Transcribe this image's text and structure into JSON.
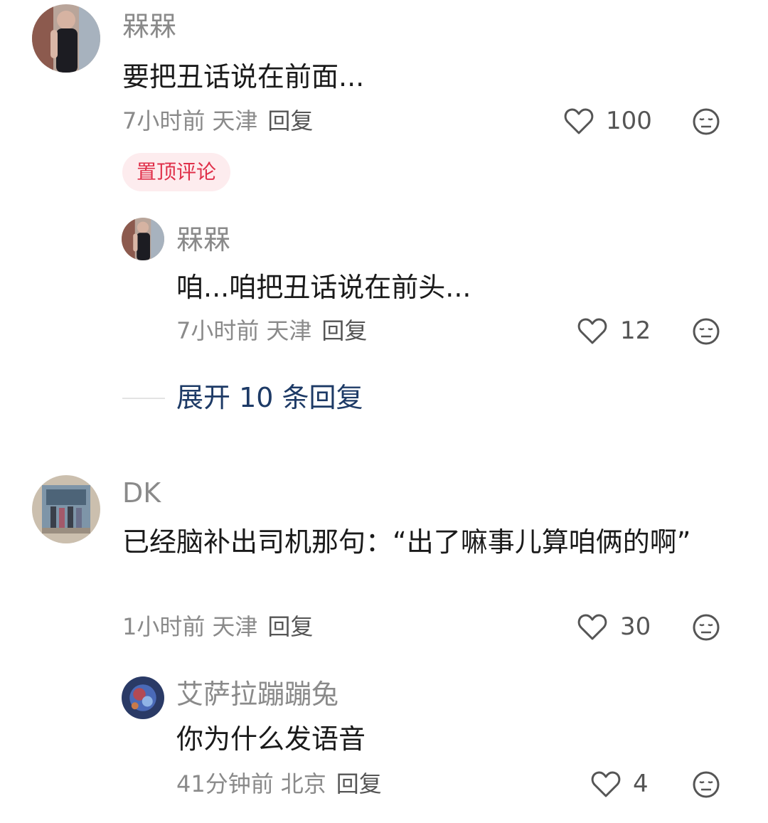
{
  "comments": [
    {
      "username": "槑槑",
      "content": "要把丑话说在前面...",
      "time": "7小时前",
      "location": "天津",
      "reply_label": "回复",
      "likes": "100",
      "badge": "置顶评论",
      "replies": [
        {
          "username": "槑槑",
          "content": "咱...咱把丑话说在前头...",
          "time": "7小时前",
          "location": "天津",
          "reply_label": "回复",
          "likes": "12"
        }
      ],
      "expand_label": "展开 10 条回复"
    },
    {
      "username": "DK",
      "content": "已经脑补出司机那句：“出了嘛事儿算咱俩的啊”",
      "time": "1小时前",
      "location": "天津",
      "reply_label": "回复",
      "likes": "30",
      "replies": [
        {
          "username": "艾萨拉蹦蹦兔",
          "content": "你为什么发语音",
          "time": "41分钟前",
          "location": "北京",
          "reply_label": "回复",
          "likes": "4"
        }
      ]
    }
  ],
  "icons": {
    "like": "heart-outline-icon",
    "dislike": "meh-face-icon"
  },
  "colors": {
    "pin_badge_text": "#e0304a",
    "pin_badge_bg": "#fdecee",
    "expand_link": "#1d3a66",
    "meta_text": "#8a8a8a"
  }
}
